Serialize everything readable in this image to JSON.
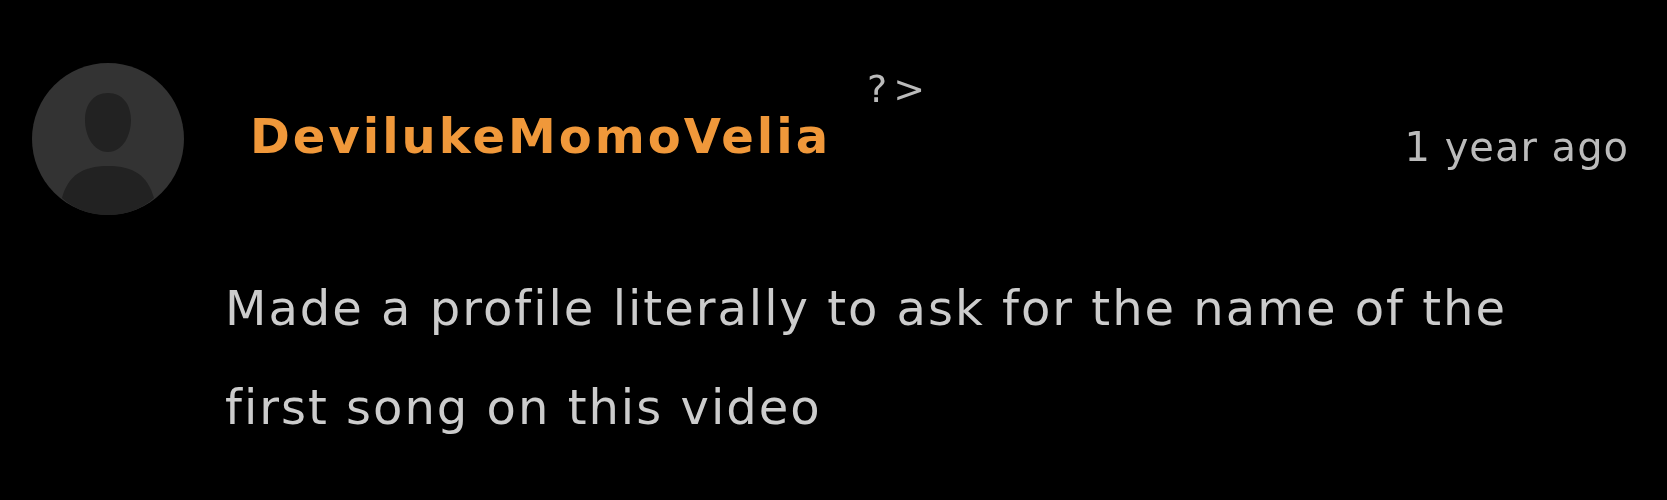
{
  "comment": {
    "author": "DevilukeMomoVelia",
    "stray_text": "?>",
    "time": "1 year ago",
    "text": "Made a profile literally to ask for the name of the first song on this video"
  }
}
